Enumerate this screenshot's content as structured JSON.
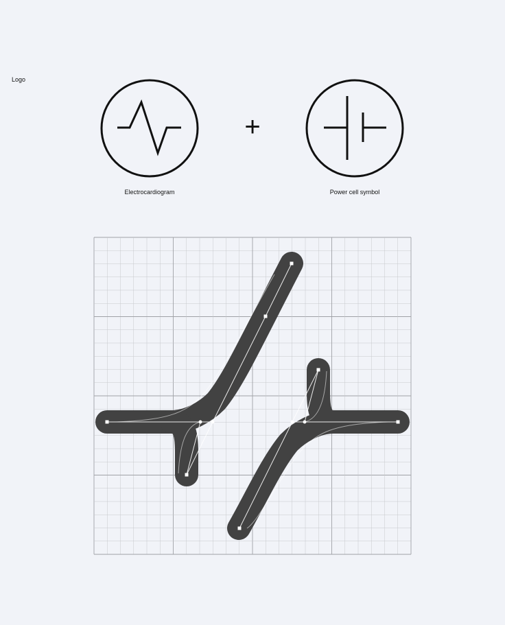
{
  "section": {
    "title": "Logo"
  },
  "concepts": [
    {
      "label": "Electrocardiogram",
      "icon": "ecg-wave-icon"
    },
    {
      "label": "Power cell symbol",
      "icon": "battery-cell-icon"
    }
  ],
  "operator": "+",
  "colors": {
    "background": "#f1f3f8",
    "stroke": "#111111",
    "shape_fill": "#424242",
    "grid_line": "#c6c8cc",
    "grid_major": "#9fa1a6",
    "construction": "#ffffff"
  }
}
